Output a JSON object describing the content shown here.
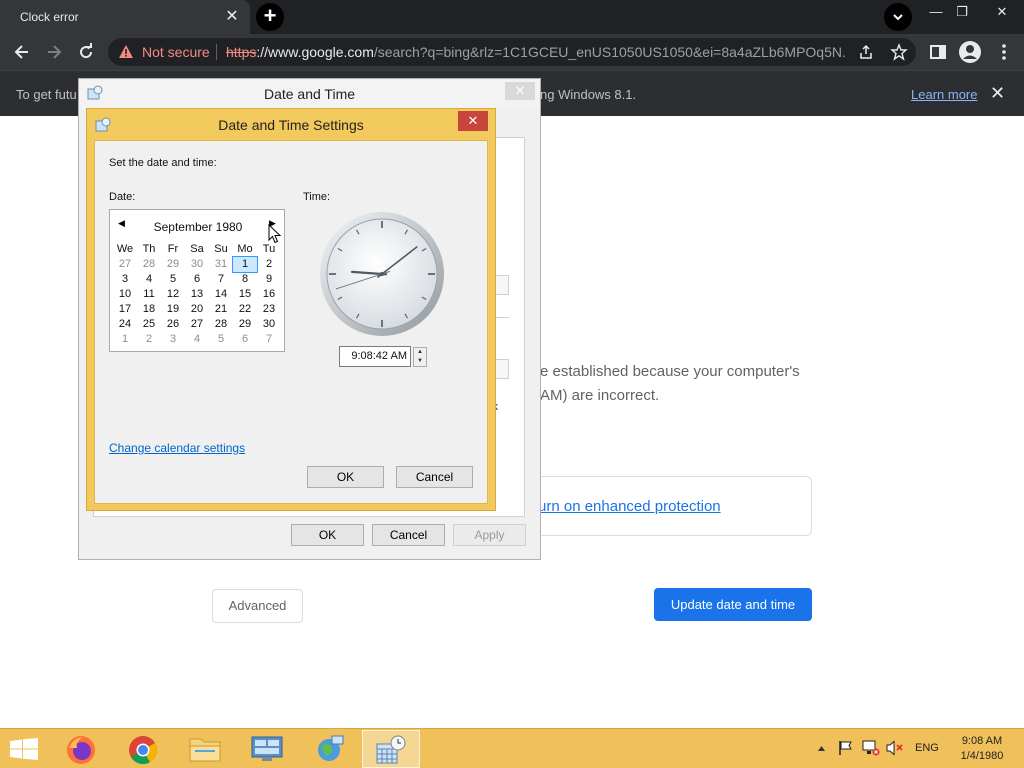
{
  "browser": {
    "tab_title": "Clock error",
    "tab_close": "✕",
    "new_tab": "+",
    "window_controls": {
      "minimize": "—",
      "restore": "❐",
      "close": "✕"
    },
    "security_label": "Not secure",
    "url_scheme": "https",
    "url_host": "://www.google.com",
    "url_path": "/search?q=bing&rlz=1C1GCEU_enUS1050US1050&ei=8a4aZLb6MPOq5N..."
  },
  "infobar": {
    "text_left": "To get futu",
    "text_right": "ng Windows 8.1.",
    "learn_more": "Learn more",
    "close": "✕"
  },
  "page": {
    "body_line1": "e established because your computer's",
    "body_line2": "AM) are incorrect.",
    "protection_link": "urn on enhanced protection",
    "advanced_button": "Advanced",
    "update_button": "Update date and time"
  },
  "dt_window": {
    "title": "Date and Time",
    "close": "✕",
    "ghost_text": "ck",
    "ok": "OK",
    "cancel": "Cancel",
    "apply": "Apply"
  },
  "dts_dialog": {
    "title": "Date and Time Settings",
    "close": "✕",
    "instruction": "Set the date and time:",
    "date_label": "Date:",
    "time_label": "Time:",
    "calendar": {
      "month": "September 1980",
      "prev": "◀",
      "next": "▶",
      "weekdays": [
        "We",
        "Th",
        "Fr",
        "Sa",
        "Su",
        "Mo",
        "Tu"
      ],
      "weeks": [
        [
          "27",
          "28",
          "29",
          "30",
          "31",
          "1",
          "2"
        ],
        [
          "3",
          "4",
          "5",
          "6",
          "7",
          "8",
          "9"
        ],
        [
          "10",
          "11",
          "12",
          "13",
          "14",
          "15",
          "16"
        ],
        [
          "17",
          "18",
          "19",
          "20",
          "21",
          "22",
          "23"
        ],
        [
          "24",
          "25",
          "26",
          "27",
          "28",
          "29",
          "30"
        ],
        [
          "1",
          "2",
          "3",
          "4",
          "5",
          "6",
          "7"
        ]
      ],
      "selected": "1"
    },
    "time_value": "9:08:42 AM",
    "clock": {
      "hour": 9,
      "minute": 8,
      "second": 42
    },
    "change_calendar_settings": "Change calendar settings",
    "ok": "OK",
    "cancel": "Cancel"
  },
  "taskbar": {
    "language": "ENG",
    "time": "9:08 AM",
    "date": "1/4/1980"
  }
}
